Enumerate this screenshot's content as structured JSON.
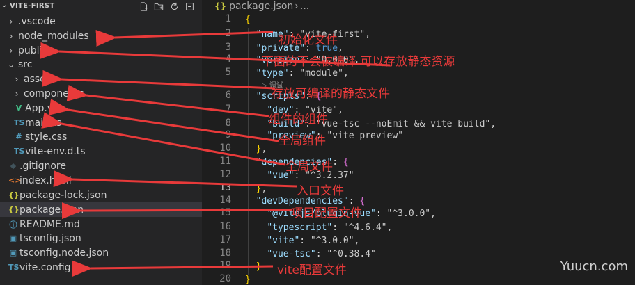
{
  "explorer": {
    "title": "VITE-FIRST",
    "items": [
      {
        "label": ".vscode",
        "kind": "folder",
        "expanded": false
      },
      {
        "label": "node_modules",
        "kind": "folder",
        "expanded": false
      },
      {
        "label": "public",
        "kind": "folder",
        "expanded": false
      },
      {
        "label": "src",
        "kind": "folder",
        "expanded": true
      },
      {
        "label": "assets",
        "kind": "folder",
        "expanded": false
      },
      {
        "label": "components",
        "kind": "folder",
        "expanded": false
      },
      {
        "label": "App.vue",
        "kind": "vue"
      },
      {
        "label": "main.ts",
        "kind": "ts"
      },
      {
        "label": "style.css",
        "kind": "css"
      },
      {
        "label": "vite-env.d.ts",
        "kind": "ts"
      },
      {
        "label": ".gitignore",
        "kind": "git"
      },
      {
        "label": "index.html",
        "kind": "html"
      },
      {
        "label": "package-lock.json",
        "kind": "json"
      },
      {
        "label": "package.json",
        "kind": "json",
        "selected": true
      },
      {
        "label": "README.md",
        "kind": "info"
      },
      {
        "label": "tsconfig.json",
        "kind": "tsconfig"
      },
      {
        "label": "tsconfig.node.json",
        "kind": "tsconfig"
      },
      {
        "label": "vite.config.ts",
        "kind": "ts"
      }
    ]
  },
  "editor": {
    "breadcrumb_file": "package.json",
    "breadcrumb_more": "...",
    "active_line": 13,
    "codelens": "▷ 调试",
    "lines": [
      {
        "n": "1",
        "text": "{"
      },
      {
        "n": "2",
        "text": "  \"name\": \"vite-first\","
      },
      {
        "n": "3",
        "text": "  \"private\": true,"
      },
      {
        "n": "4",
        "text": "  \"version\": \"0.0.0\","
      },
      {
        "n": "5",
        "text": "  \"type\": \"module\","
      },
      {
        "n": "6",
        "text": "  \"scripts\": {"
      },
      {
        "n": "7",
        "text": "    \"dev\": \"vite\","
      },
      {
        "n": "8",
        "text": "    \"build\": \"vue-tsc --noEmit && vite build\","
      },
      {
        "n": "9",
        "text": "    \"preview\": \"vite preview\""
      },
      {
        "n": "10",
        "text": "  },"
      },
      {
        "n": "11",
        "text": "  \"dependencies\": {"
      },
      {
        "n": "12",
        "text": "    \"vue\": \"^3.2.37\""
      },
      {
        "n": "13",
        "text": "  },"
      },
      {
        "n": "14",
        "text": "  \"devDependencies\": {"
      },
      {
        "n": "15",
        "text": "    \"@vitejs/plugin-vue\": \"^3.0.0\","
      },
      {
        "n": "16",
        "text": "    \"typescript\": \"^4.6.4\","
      },
      {
        "n": "17",
        "text": "    \"vite\": \"^3.0.0\","
      },
      {
        "n": "18",
        "text": "    \"vue-tsc\": \"^0.38.4\""
      },
      {
        "n": "19",
        "text": "  }"
      },
      {
        "n": "20",
        "text": "}"
      }
    ]
  },
  "annotations": [
    {
      "text": "初始化文件"
    },
    {
      "text": "下面的不会被编译 可以存放静态资源"
    },
    {
      "text": "存放可编译的静态文件"
    },
    {
      "text": "组件的组件"
    },
    {
      "text": "全局组件"
    },
    {
      "text": "全局文件"
    },
    {
      "text": "入口文件"
    },
    {
      "text": "项目配置文件"
    },
    {
      "text": "vite配置文件"
    }
  ],
  "watermark": "Yuucn.com",
  "colors": {
    "annotation": "#e83a3a",
    "arrow": "#e83a3a",
    "sidebar_bg": "#252526",
    "editor_bg": "#1e1e1e"
  }
}
